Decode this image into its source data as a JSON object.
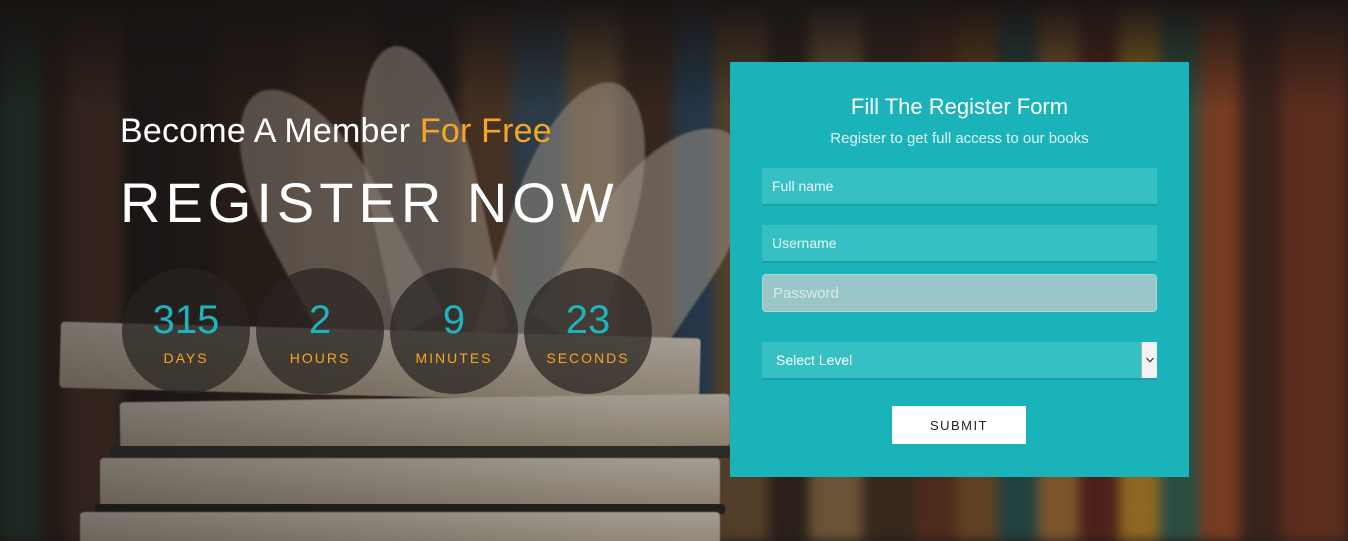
{
  "hero": {
    "subtitle_main": "Become A Member",
    "subtitle_accent": "For Free",
    "title": "REGISTER NOW"
  },
  "countdown": [
    {
      "value": "315",
      "label": "DAYS"
    },
    {
      "value": "2",
      "label": "HOURS"
    },
    {
      "value": "9",
      "label": "MINUTES"
    },
    {
      "value": "23",
      "label": "SECONDS"
    }
  ],
  "form": {
    "title": "Fill The Register Form",
    "subtitle": "Register to get full access to our books",
    "fullname_placeholder": "Full name",
    "username_placeholder": "Username",
    "password_placeholder": "Password",
    "level_selected": "Select Level",
    "submit_label": "SUBMIT"
  },
  "colors": {
    "accent_orange": "#f5a623",
    "teal": "#1ab3b9",
    "countdown_value": "#1eb4bb"
  }
}
